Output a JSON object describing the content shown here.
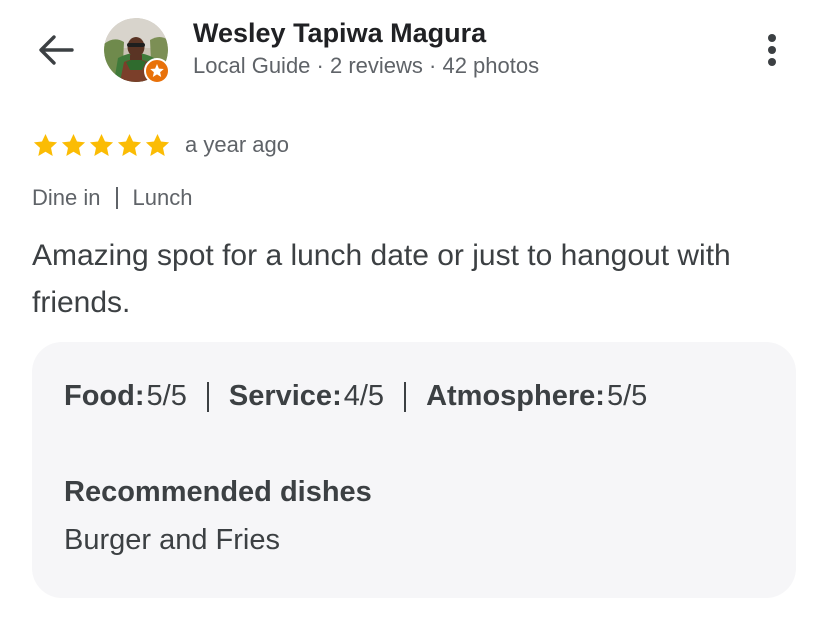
{
  "header": {
    "back_icon": "arrow-back-icon",
    "user": {
      "name": "Wesley Tapiwa Magura",
      "level": "Local Guide",
      "reviews": "2 reviews",
      "photos": "42 photos",
      "meta_separator": " · ",
      "badge_icon": "local-guide-star-icon",
      "badge_color": "#e8710a"
    },
    "more_icon": "more-vert-icon"
  },
  "review": {
    "stars": 5,
    "stars_max": 5,
    "star_color": "#fbbc04",
    "date": "a year ago",
    "visit_tags": [
      "Dine in",
      "Lunch"
    ],
    "text": "Amazing spot for a lunch date or just to hangout with friends."
  },
  "details": {
    "ratings": [
      {
        "label": "Food",
        "value": "5/5"
      },
      {
        "label": "Service",
        "value": "4/5"
      },
      {
        "label": "Atmosphere",
        "value": "5/5"
      }
    ],
    "recommended_title": "Recommended dishes",
    "recommended_dishes": "Burger and Fries"
  }
}
